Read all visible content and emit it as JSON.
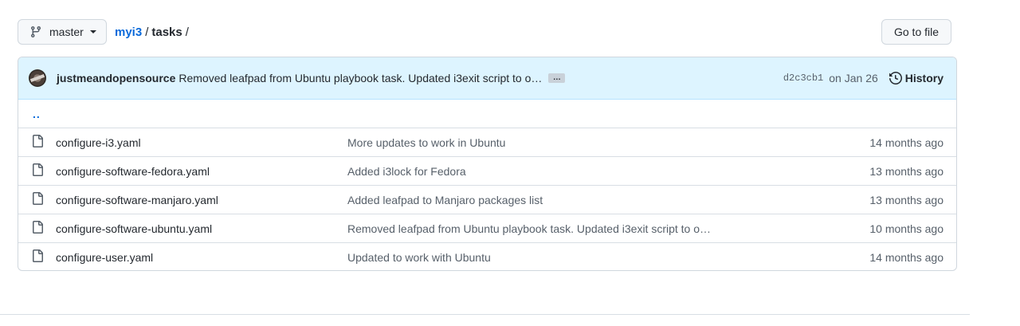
{
  "branch": {
    "name": "master"
  },
  "breadcrumb": {
    "repo": "myi3",
    "separator": "/",
    "dir": "tasks",
    "trailing": "/"
  },
  "goto_file": {
    "label": "Go to file"
  },
  "commit": {
    "author": "justmeandopensource",
    "message": "Removed leafpad from Ubuntu playbook task. Updated i3exit script to o…",
    "ellipsis": "…",
    "sha": "d2c3cb1",
    "date": "on Jan 26",
    "history_label": "History"
  },
  "parent_dir": {
    "label": ".."
  },
  "files": [
    {
      "name": "configure-i3.yaml",
      "message": "More updates to work in Ubuntu",
      "age": "14 months ago",
      "icon": "file-icon"
    },
    {
      "name": "configure-software-fedora.yaml",
      "message": "Added i3lock for Fedora",
      "age": "13 months ago",
      "icon": "file-icon"
    },
    {
      "name": "configure-software-manjaro.yaml",
      "message": "Added leafpad to Manjaro packages list",
      "age": "13 months ago",
      "icon": "file-icon"
    },
    {
      "name": "configure-software-ubuntu.yaml",
      "message": "Removed leafpad from Ubuntu playbook task. Updated i3exit script to o…",
      "age": "10 months ago",
      "icon": "file-icon"
    },
    {
      "name": "configure-user.yaml",
      "message": "Updated to work with Ubuntu",
      "age": "14 months ago",
      "icon": "file-icon"
    }
  ],
  "colors": {
    "link": "#0969da",
    "commit_bar_bg": "#ddf4ff",
    "border": "#d0d7de",
    "muted": "#57606a"
  }
}
